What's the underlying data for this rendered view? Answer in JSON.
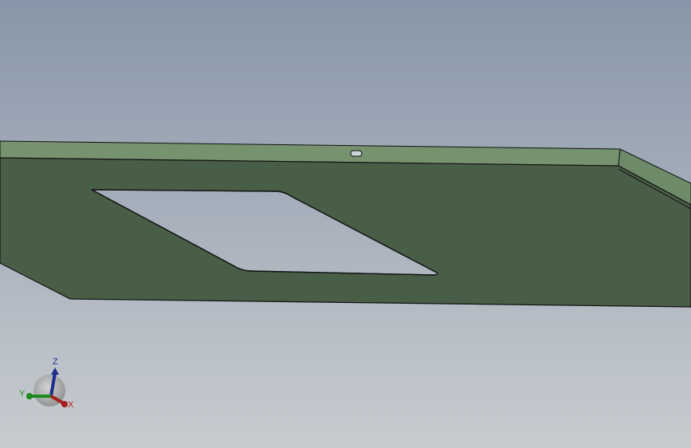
{
  "viewport": {
    "background_top_color": "#8896a9",
    "background_bottom_color": "#c8ccd0"
  },
  "model": {
    "top_face_color": "#495e47",
    "front_edge_color": "#77926f",
    "side_edge_color": "#6e8a68",
    "outline_color": "#111111"
  },
  "triad": {
    "z_label": "Z",
    "y_label": "Y",
    "x_label": "X",
    "z_color": "#1a2d8c",
    "y_color": "#1d8a1d",
    "x_color": "#a81c1c"
  }
}
